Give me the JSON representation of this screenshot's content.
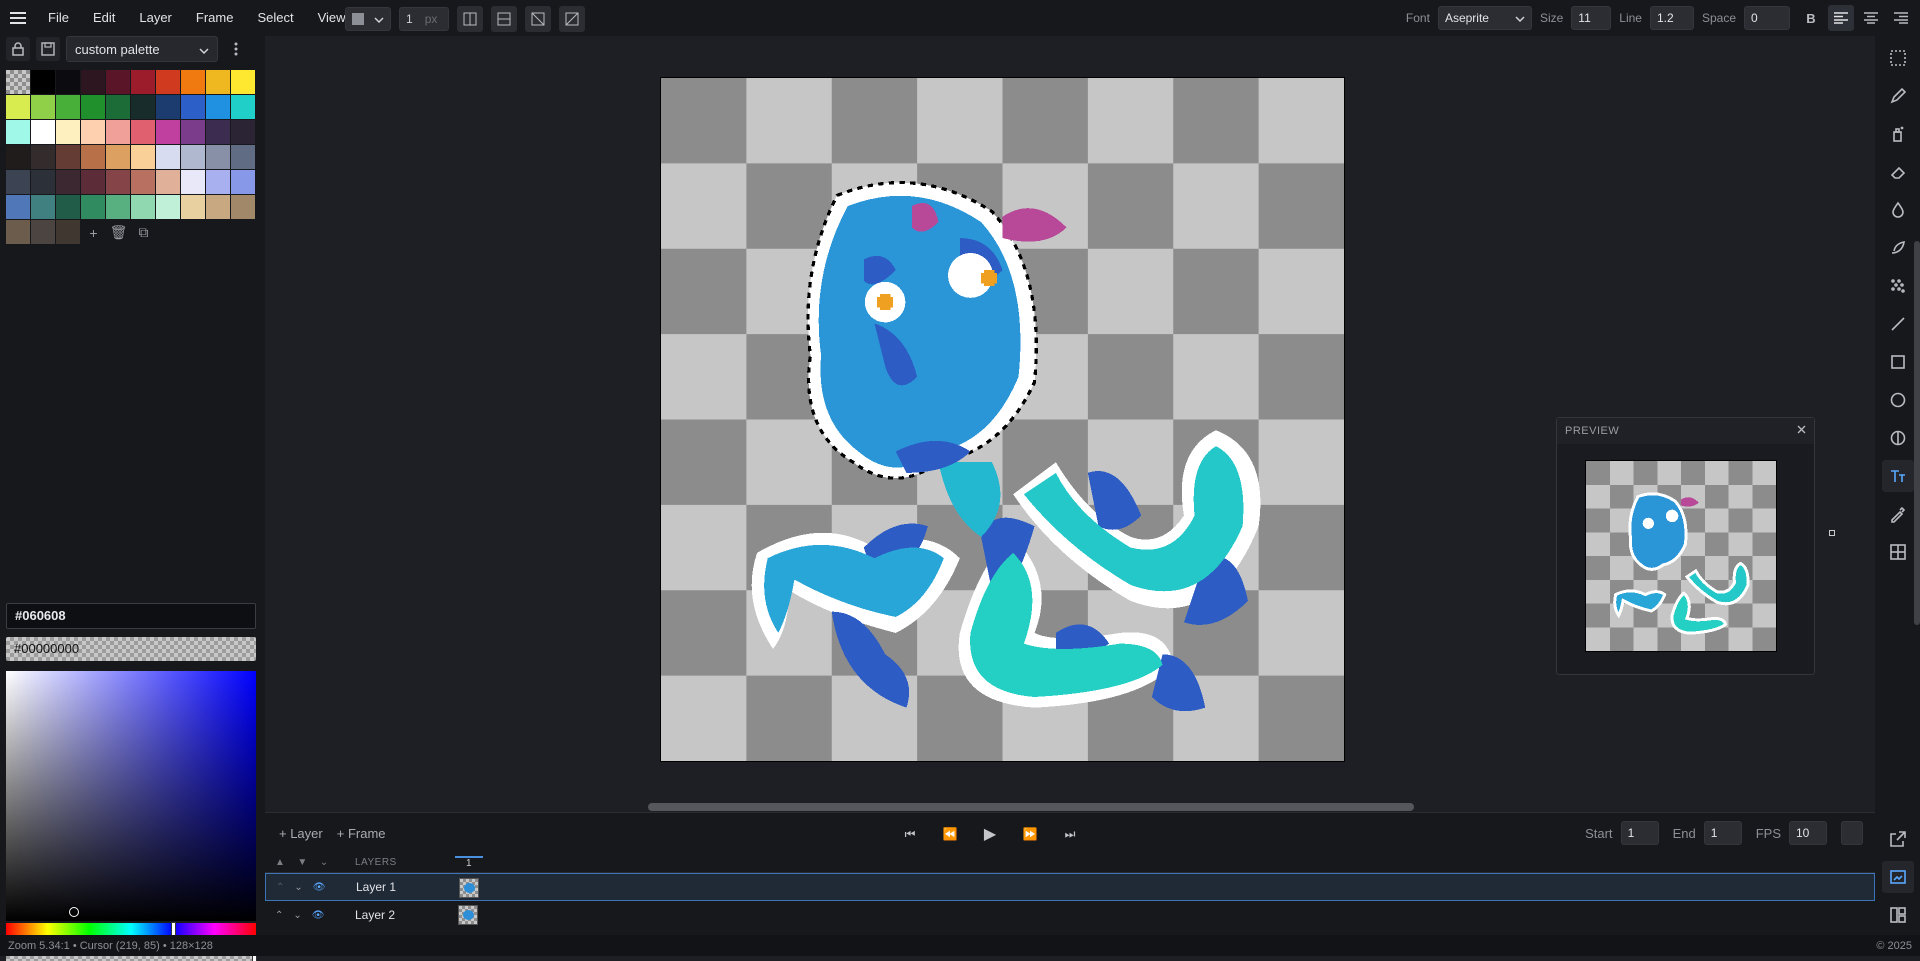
{
  "menu": {
    "items": [
      "File",
      "Edit",
      "Layer",
      "Frame",
      "Select",
      "View"
    ]
  },
  "tool_options": {
    "brush_size": "1",
    "brush_unit": "px"
  },
  "text_options": {
    "font_label": "Font",
    "font_value": "Aseprite",
    "size_label": "Size",
    "size_value": "11",
    "line_label": "Line",
    "line_value": "1.2",
    "space_label": "Space",
    "space_value": "0",
    "bold_label": "B"
  },
  "palette": {
    "name": "custom palette",
    "colors": [
      "#000000",
      "#0c0c10",
      "#2e1620",
      "#5a1628",
      "#9c1c2c",
      "#d03a1e",
      "#f07a10",
      "#f0b820",
      "#ffe830",
      "#d8ec50",
      "#90d048",
      "#48b038",
      "#20902c",
      "#1c6c38",
      "#182c2c",
      "#1c3c70",
      "#2c60c8",
      "#2090e0",
      "#20d0c8",
      "#a0f8e8",
      "#ffffff",
      "#fff0c0",
      "#ffd0b0",
      "#f0a098",
      "#e06070",
      "#c040a0",
      "#7c3c8c",
      "#3c2c50",
      "#2a2434",
      "#201c1c",
      "#342c2c",
      "#643c34",
      "#b87048",
      "#dca060",
      "#f8d098",
      "#d8dcf0",
      "#b0b8d0",
      "#8890a8",
      "#606c84",
      "#3c4454",
      "#2c3038",
      "#3c2830",
      "#5c2c38",
      "#844448",
      "#b87060",
      "#e0b098",
      "#e8e8f8",
      "#a8b0f0",
      "#8898e8",
      "#5078b8",
      "#408080",
      "#205c48",
      "#308c60",
      "#58b080",
      "#90d8b0",
      "#c0f0d8",
      "#e8d0a0",
      "#c8a880",
      "#a08868",
      "#6c5c4c",
      "#4c4440",
      "#403830"
    ]
  },
  "color": {
    "primary_hex": "#060608",
    "secondary_hex": "#00000000"
  },
  "preview": {
    "title": "PREVIEW"
  },
  "timeline": {
    "add_layer": "+ Layer",
    "add_frame": "+ Frame",
    "start_label": "Start",
    "start_value": "1",
    "end_label": "End",
    "end_value": "1",
    "fps_label": "FPS",
    "fps_value": "10",
    "layers_header": "LAYERS",
    "frame_number": "1",
    "layers": [
      {
        "name": "Layer 1"
      },
      {
        "name": "Layer 2"
      }
    ]
  },
  "status": {
    "left": "Zoom 5.34:1 • Cursor (219, 85) • 128×128",
    "right": "© 2025"
  }
}
